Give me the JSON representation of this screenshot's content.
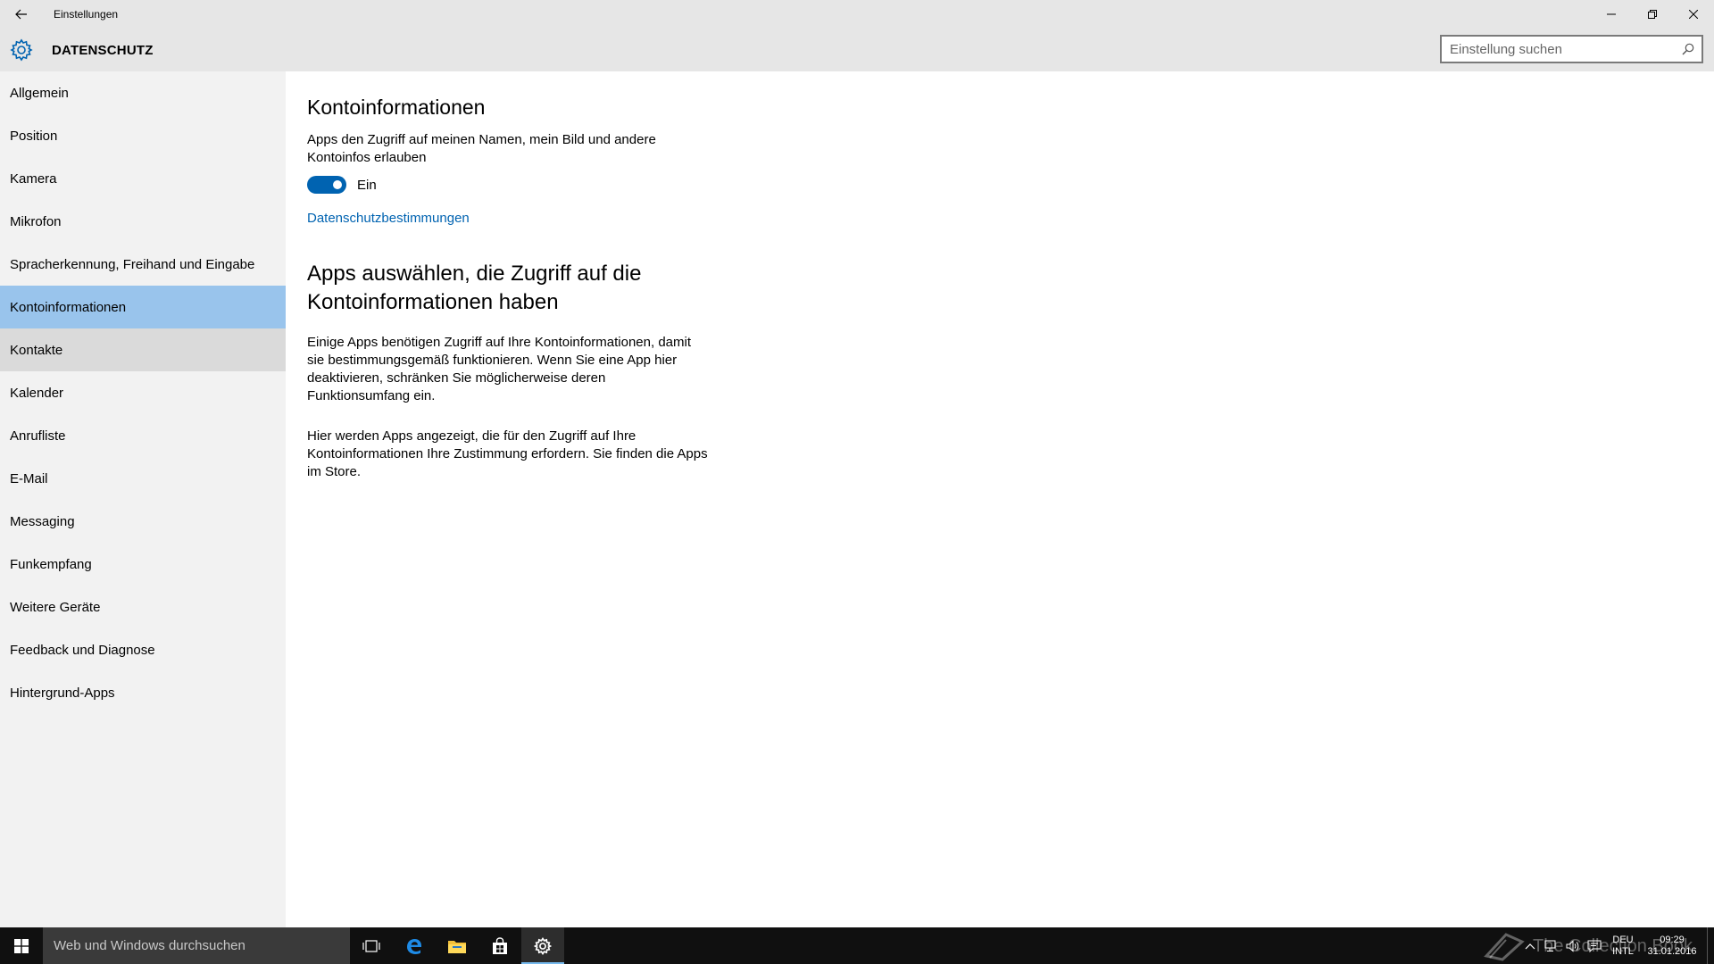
{
  "window": {
    "title": "Einstellungen"
  },
  "header": {
    "section_title": "DATENSCHUTZ",
    "search_placeholder": "Einstellung suchen"
  },
  "sidebar": {
    "items": [
      {
        "label": "Allgemein"
      },
      {
        "label": "Position"
      },
      {
        "label": "Kamera"
      },
      {
        "label": "Mikrofon"
      },
      {
        "label": "Spracherkennung, Freihand und Eingabe"
      },
      {
        "label": "Kontoinformationen",
        "selected": true
      },
      {
        "label": "Kontakte",
        "hover": true
      },
      {
        "label": "Kalender"
      },
      {
        "label": "Anrufliste"
      },
      {
        "label": "E-Mail"
      },
      {
        "label": "Messaging"
      },
      {
        "label": "Funkempfang"
      },
      {
        "label": "Weitere Geräte"
      },
      {
        "label": "Feedback und Diagnose"
      },
      {
        "label": "Hintergrund-Apps"
      }
    ]
  },
  "content": {
    "heading": "Kontoinformationen",
    "description": "Apps den Zugriff auf meinen Namen, mein Bild und andere Kontoinfos erlauben",
    "toggle": {
      "state": "on",
      "label": "Ein"
    },
    "privacy_link": "Datenschutzbestimmungen",
    "subheading": "Apps auswählen, die Zugriff auf die Kontoinformationen haben",
    "paragraph1": "Einige Apps benötigen Zugriff auf Ihre Kontoinformationen, damit sie bestimmungsgemäß funktionieren. Wenn Sie eine App hier deaktivieren, schränken Sie möglicherweise deren Funktionsumfang ein.",
    "paragraph2": "Hier werden Apps angezeigt, die für den Zugriff auf Ihre Kontoinformationen Ihre Zustimmung erfordern. Sie finden die Apps im Store."
  },
  "taskbar": {
    "search_text": "Web und Windows durchsuchen",
    "lang_line1": "DEU",
    "lang_line2": "INTL",
    "time": "09:29",
    "date": "31.01.2016",
    "watermark": "The Collection Book"
  },
  "colors": {
    "accent": "#0063b1",
    "selected_bg": "#99c4ec",
    "sidebar_bg": "#f2f2f2",
    "header_bg": "#e6e6e6",
    "taskbar_bg": "#101010"
  }
}
